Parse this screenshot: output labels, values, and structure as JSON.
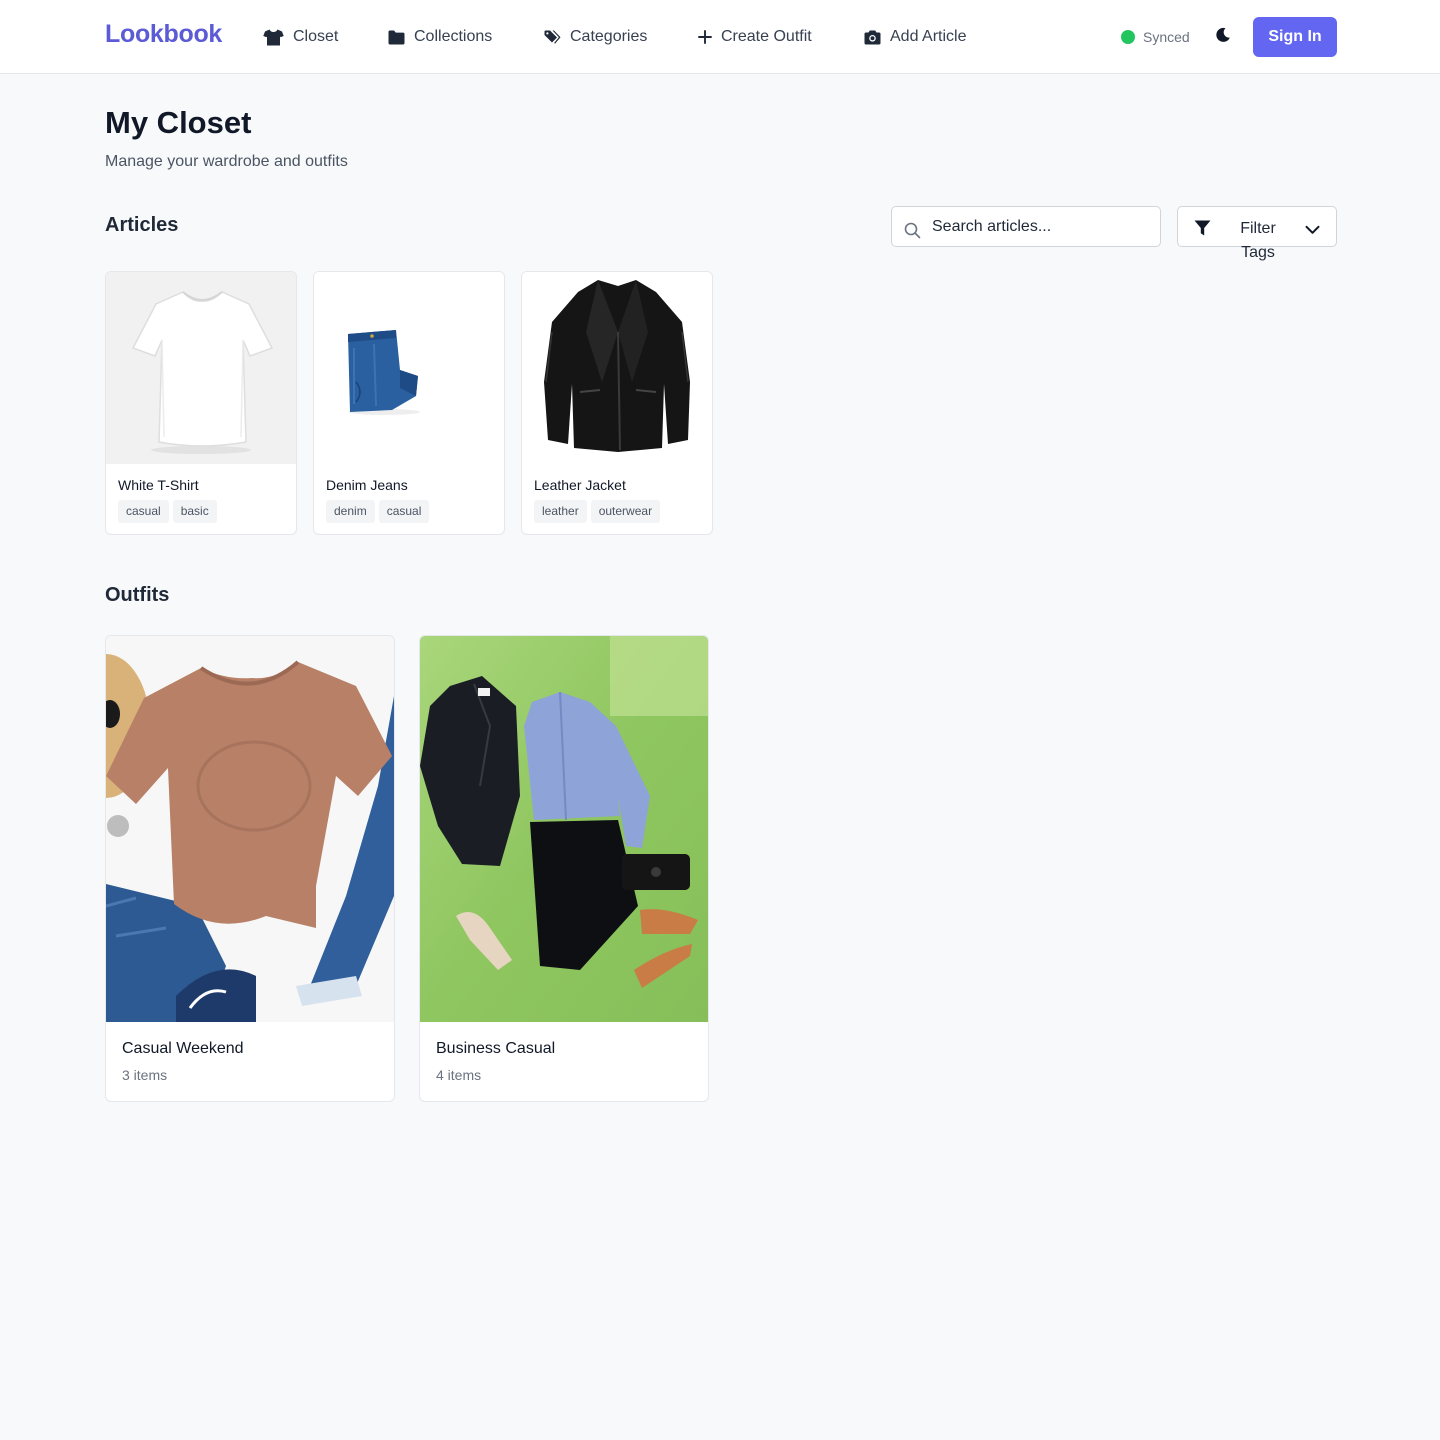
{
  "header": {
    "brand": "Lookbook",
    "nav": [
      {
        "label": "Closet",
        "icon": "shirt-icon"
      },
      {
        "label": "Collections",
        "icon": "folder-icon"
      },
      {
        "label": "Categories",
        "icon": "tags-icon"
      },
      {
        "label": "Create Outfit",
        "icon": "plus-icon"
      },
      {
        "label": "Add Article",
        "icon": "camera-icon"
      }
    ],
    "sync_status": "Synced",
    "sync_color": "#22c55e",
    "theme_icon": "moon-icon",
    "sign_in_label": "Sign In",
    "accent_color": "#6366f1"
  },
  "page": {
    "title": "My Closet",
    "subtitle": "Manage your wardrobe and outfits"
  },
  "articles": {
    "section_title": "Articles",
    "search_placeholder": "Search articles...",
    "filter_label": "Filter Tags",
    "items": [
      {
        "name": "White T-Shirt",
        "tags": [
          "casual",
          "basic"
        ],
        "image": "white-tshirt-photo"
      },
      {
        "name": "Denim Jeans",
        "tags": [
          "denim",
          "casual"
        ],
        "image": "denim-jeans-photo"
      },
      {
        "name": "Leather Jacket",
        "tags": [
          "leather",
          "outerwear"
        ],
        "image": "leather-jacket-photo"
      }
    ]
  },
  "outfits": {
    "section_title": "Outfits",
    "items": [
      {
        "name": "Casual Weekend",
        "count": "3 items",
        "image": "casual-weekend-photo"
      },
      {
        "name": "Business Casual",
        "count": "4 items",
        "image": "business-casual-photo"
      }
    ]
  }
}
